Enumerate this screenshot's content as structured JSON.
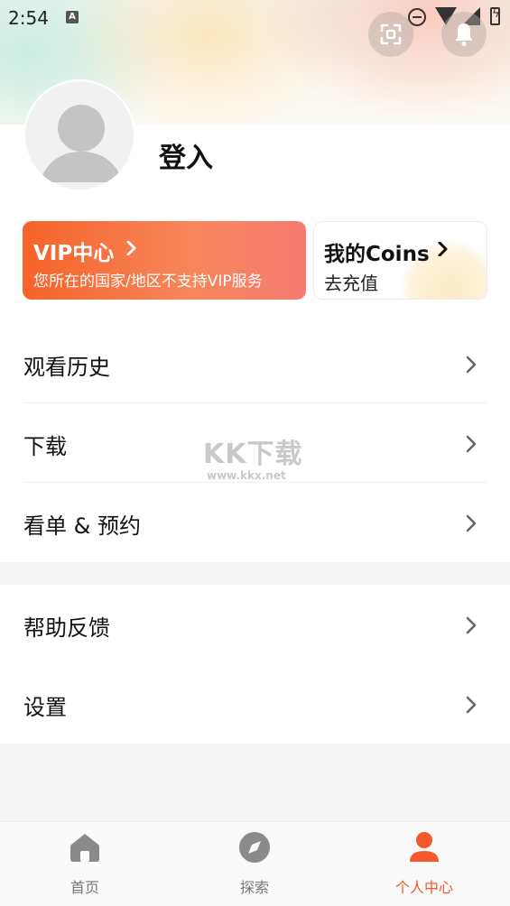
{
  "status_bar": {
    "time": "2:54",
    "notification_badge": "A"
  },
  "header": {
    "scan_icon": "scan-icon",
    "bell_icon": "bell-icon"
  },
  "profile": {
    "login_label": "登入"
  },
  "vip_card": {
    "title": "VIP中心",
    "subtitle": "您所在的国家/地区不支持VIP服务"
  },
  "coins_card": {
    "title": "我的Coins",
    "subtitle": "去充值"
  },
  "menu_section_1": [
    {
      "label": "观看历史"
    },
    {
      "label": "下载"
    },
    {
      "label": "看单 & 预约"
    }
  ],
  "menu_section_2": [
    {
      "label": "帮助反馈"
    },
    {
      "label": "设置"
    }
  ],
  "watermark": {
    "big": "KK下载",
    "small": "www.kkx.net"
  },
  "tabbar": [
    {
      "label": "首页",
      "icon": "home-icon",
      "active": false
    },
    {
      "label": "探索",
      "icon": "compass-icon",
      "active": false
    },
    {
      "label": "个人中心",
      "icon": "person-icon",
      "active": true
    }
  ],
  "colors": {
    "accent": "#f4582b",
    "vip_start": "#f6632a",
    "vip_end": "#f57b70"
  }
}
